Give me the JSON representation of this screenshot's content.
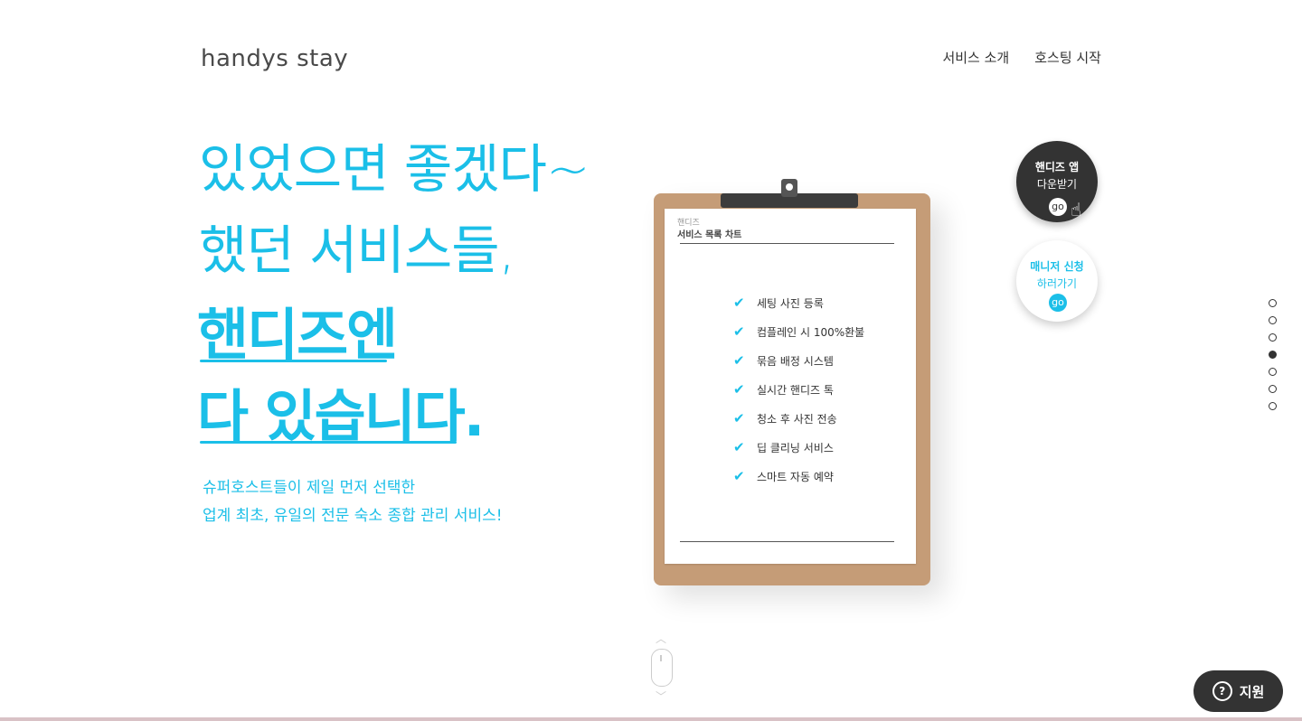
{
  "header": {
    "logo": "handys stay",
    "nav": [
      "서비스 소개",
      "호스팅 시작"
    ]
  },
  "hero": {
    "line1": "있었으면 좋겠다~",
    "line2": "했던 서비스들,",
    "bold1": "핸디즈엔",
    "bold2": "다 있습니다.",
    "sub1": "슈퍼호스트들이 제일 먼저 선택한",
    "sub2": "업계 최초, 유일의 전문 숙소 종합 관리 서비스!"
  },
  "clipboard": {
    "brand": "핸디즈",
    "title": "서비스 목록 차트",
    "items": [
      "세팅 사진 등록",
      "컴플레인 시 100%환불",
      "묶음 배정 시스템",
      "실시간 핸디즈 톡",
      "청소 후 사진 전송",
      "딥 클리닝 서비스",
      "스마트 자동 예약"
    ]
  },
  "side": {
    "app_title": "핸디즈 앱",
    "app_sub": "다운받기",
    "app_go": "go",
    "mgr_title": "매니저 신청",
    "mgr_sub": "하러가기",
    "mgr_go": "go"
  },
  "dots": {
    "count": 7,
    "active_index": 3
  },
  "support": {
    "label": "지원",
    "icon": "question-icon"
  },
  "colors": {
    "accent": "#1bbfe8",
    "dark": "#333333",
    "clipboard": "#c59c77"
  }
}
